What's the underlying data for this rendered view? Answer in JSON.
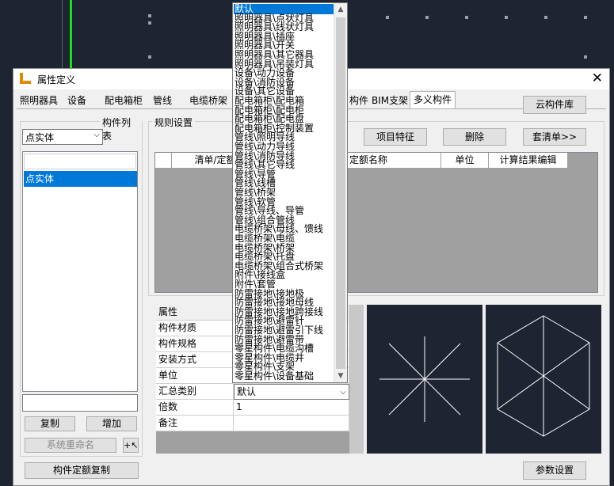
{
  "dialog": {
    "title": "属性定义",
    "close": "✕",
    "tabs": [
      "照明器具",
      "设备",
      "配电箱柜",
      "管线",
      "电缆桥架",
      "构件",
      "BIM支架",
      "多义构件"
    ],
    "cloud_library": "云构件库",
    "component_list_label": "构件列表",
    "type_combo": "点实体",
    "list_items": [
      "",
      "点实体"
    ],
    "rename_input": "",
    "copy": "复制",
    "add": "增加",
    "system_rename": "系统重命名",
    "quota_copy": "构件定额复制",
    "rules_label": "规则设置",
    "project_feature": "项目特征",
    "delete": "删除",
    "apply_list": "套清单>>",
    "grid_headers": [
      "",
      "清单/定额",
      "定额名称",
      "单位",
      "计算结果编辑"
    ],
    "properties": [
      {
        "name": "属性",
        "value": ""
      },
      {
        "name": "构件材质",
        "value": ""
      },
      {
        "name": "构件规格",
        "value": ""
      },
      {
        "name": "安装方式",
        "value": ""
      },
      {
        "name": "单位",
        "value": ""
      },
      {
        "name": "汇总类别",
        "value": "默认"
      },
      {
        "name": "倍数",
        "value": "1"
      },
      {
        "name": "备注",
        "value": ""
      }
    ],
    "param_settings": "参数设置"
  },
  "dropdown": {
    "selected": "默认",
    "options": [
      "默认",
      "照明器具\\点状灯具",
      "照明器具\\线状灯具",
      "照明器具\\插座",
      "照明器具\\开关",
      "照明器具\\其它器具",
      "照明器具\\吊装灯具",
      "设备\\动力设备",
      "设备\\消防设备",
      "设备\\其它设备",
      "配电箱柜\\配电箱",
      "配电箱柜\\配电柜",
      "配电箱柜\\配电盘",
      "配电箱柜\\控制装置",
      "管线\\照明导线",
      "管线\\动力导线",
      "管线\\消防导线",
      "管线\\其它导线",
      "管线\\导管",
      "管线\\线槽",
      "管线\\桥架",
      "管线\\软管",
      "管线\\导线、导管",
      "管线\\组合管线",
      "电缆桥架\\母线、馈线",
      "电缆桥架\\电缆",
      "电缆桥架\\桥架",
      "电缆桥架\\托盘",
      "电缆桥架\\组合式桥架",
      "附件\\接线盒",
      "附件\\套管",
      "防雷接地\\接地极",
      "防雷接地\\接地母线",
      "防雷接地\\接地跨接线",
      "防雷接地\\避雷针",
      "防雷接地\\避雷引下线",
      "防雷接地\\避雷带",
      "零星构件\\电缆沟槽",
      "零星构件\\电缆井",
      "零星构件\\支架",
      "零星构件\\设备基础"
    ]
  }
}
